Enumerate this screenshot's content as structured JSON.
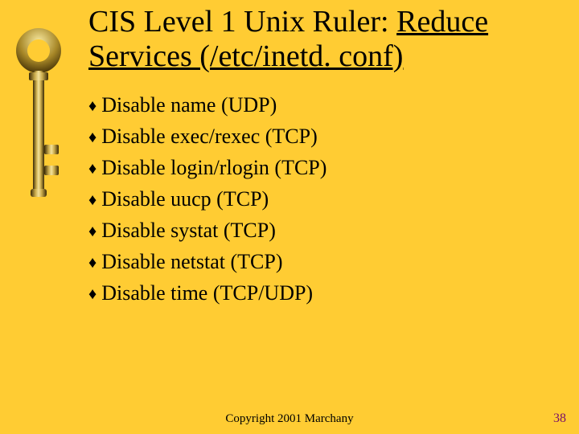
{
  "title": {
    "plain": "CIS Level 1 Unix Ruler: ",
    "underlined": "Reduce Services (/etc/inetd. conf)"
  },
  "bullets": [
    "Disable name (UDP)",
    "Disable exec/rexec (TCP)",
    "Disable login/rlogin (TCP)",
    "Disable uucp (TCP)",
    "Disable systat (TCP)",
    "Disable netstat (TCP)",
    "Disable time (TCP/UDP)"
  ],
  "footer": "Copyright 2001 Marchany",
  "page_number": "38"
}
